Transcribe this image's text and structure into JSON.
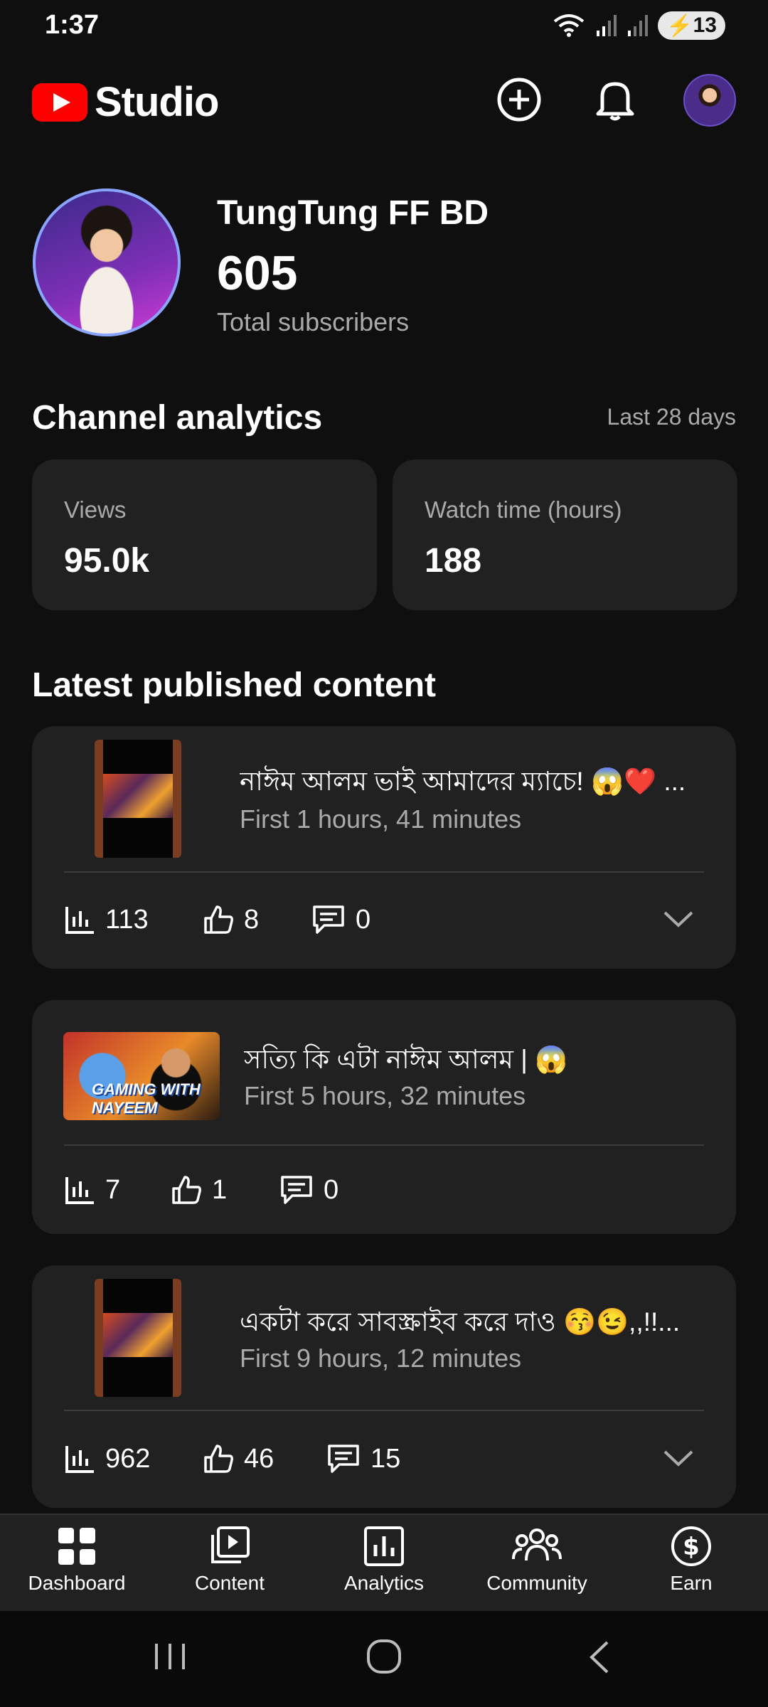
{
  "status_bar": {
    "time": "1:37",
    "battery": "13"
  },
  "header": {
    "logo_text": "Studio"
  },
  "channel": {
    "name": "TungTung FF BD",
    "subscribers": "605",
    "subscribers_label": "Total subscribers"
  },
  "analytics": {
    "title": "Channel analytics",
    "period": "Last 28 days",
    "views_label": "Views",
    "views_value": "95.0k",
    "watch_label": "Watch time (hours)",
    "watch_value": "188"
  },
  "latest": {
    "title": "Latest published content",
    "items": [
      {
        "title": "নাঈম আলম ভাই আমাদের ম্যাচে! 😱❤️ ...",
        "subtitle": "First 1 hours, 41 minutes",
        "views": "113",
        "likes": "8",
        "comments": "0"
      },
      {
        "title": "সত্যি কি এটা নাঈম আলম | 😱",
        "subtitle": "First 5 hours, 32 minutes",
        "views": "7",
        "likes": "1",
        "comments": "0",
        "thumb_text": "GAMING WITH NAYEEM"
      },
      {
        "title": "একটা করে সাবস্ক্রাইব করে দাও 😚😉,,!!...",
        "subtitle": "First 9 hours, 12 minutes",
        "views": "962",
        "likes": "46",
        "comments": "15"
      }
    ]
  },
  "bottom_nav": [
    {
      "label": "Dashboard",
      "icon": "dashboard-icon"
    },
    {
      "label": "Content",
      "icon": "content-icon"
    },
    {
      "label": "Analytics",
      "icon": "analytics-icon"
    },
    {
      "label": "Community",
      "icon": "community-icon"
    },
    {
      "label": "Earn",
      "icon": "earn-icon"
    }
  ]
}
